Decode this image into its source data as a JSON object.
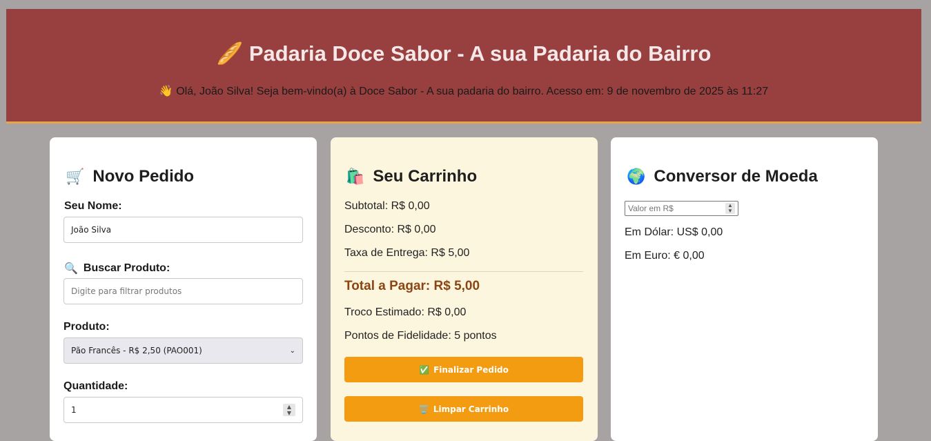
{
  "header": {
    "icon": "🥖",
    "title": "Padaria Doce Sabor - A sua Padaria do Bairro",
    "welcome_icon": "👋",
    "welcome": "Olá, João Silva! Seja bem-vindo(a) à Doce Sabor - A sua padaria do bairro. Acesso em: 9 de novembro de 2025 às 11:27"
  },
  "pedido": {
    "icon": "🛒",
    "title": "Novo Pedido",
    "nome_label": "Seu Nome:",
    "nome_value": "João Silva",
    "buscar_icon": "🔍",
    "buscar_label": "Buscar Produto:",
    "buscar_placeholder": "Digite para filtrar produtos",
    "produto_label": "Produto:",
    "produto_selected": "Pão Francês - R$ 2,50 (PAO001)",
    "quantidade_label": "Quantidade:",
    "quantidade_value": "1"
  },
  "carrinho": {
    "icon": "🛍️",
    "title": "Seu Carrinho",
    "subtotal": "Subtotal: R$ 0,00",
    "desconto": "Desconto: R$ 0,00",
    "taxa": "Taxa de Entrega: R$ 5,00",
    "total": "Total a Pagar: R$ 5,00",
    "troco": "Troco Estimado: R$ 0,00",
    "pontos": "Pontos de Fidelidade: 5 pontos",
    "finalizar_icon": "✅",
    "finalizar_label": "Finalizar Pedido",
    "limpar_icon": "🗑️",
    "limpar_label": "Limpar Carrinho"
  },
  "conversor": {
    "icon": "🌍",
    "title": "Conversor de Moeda",
    "valor_placeholder": "Valor em R$",
    "dolar": "Em Dólar: US$ 0,00",
    "euro": "Em Euro: € 0,00"
  },
  "colors": {
    "header_bg": "#983f3f",
    "accent": "#f39c12",
    "total_text": "#8b4513",
    "page_bg": "#a8a3a3"
  }
}
